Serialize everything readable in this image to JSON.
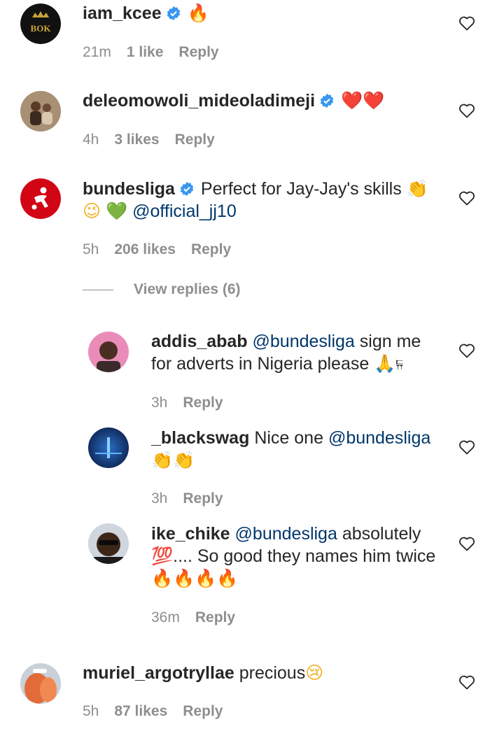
{
  "comments": [
    {
      "username": "iam_kcee",
      "verified": true,
      "text_emoji": "🔥",
      "time": "21m",
      "likes": "1 like",
      "reply": "Reply"
    },
    {
      "username": "deleomowoli_mideoladimeji",
      "verified": true,
      "text_emoji": "❤️❤️",
      "time": "4h",
      "likes": "3 likes",
      "reply": "Reply"
    },
    {
      "username": "bundesliga",
      "verified": true,
      "text_line1": "Perfect for Jay-Jay's skills",
      "emoji_clap": "👏",
      "emoji_wink": "😉",
      "emoji_green_heart": "💚",
      "mention": "@official_jj10",
      "time": "5h",
      "likes": "206 likes",
      "reply": "Reply",
      "view_replies": "View replies (6)"
    },
    {
      "username": "muriel_argotryllae",
      "text": "precious",
      "emoji": "😢",
      "time": "5h",
      "likes": "87 likes",
      "reply": "Reply"
    }
  ],
  "replies": [
    {
      "username": "addis_abab",
      "mention": "@bundesliga",
      "text_a": "sign me",
      "text_b": "for adverts in Nigeria please",
      "emoji": "🙏",
      "tail": "𐏂",
      "time": "3h",
      "reply": "Reply"
    },
    {
      "username": "_blackswag",
      "text": "Nice one",
      "mention": "@bundesliga",
      "emoji": "👏👏",
      "time": "3h",
      "reply": "Reply"
    },
    {
      "username": "ike_chike",
      "mention": "@bundesliga",
      "text_a": "absolutely",
      "emoji_100": "💯",
      "text_b": ".... So good they names him twice",
      "emoji_fire": "🔥🔥🔥🔥",
      "time": "36m",
      "reply": "Reply"
    }
  ],
  "colors": {
    "text": "#262626",
    "meta": "#8e8e8e",
    "mention": "#00376b",
    "verified": "#3897f0"
  }
}
